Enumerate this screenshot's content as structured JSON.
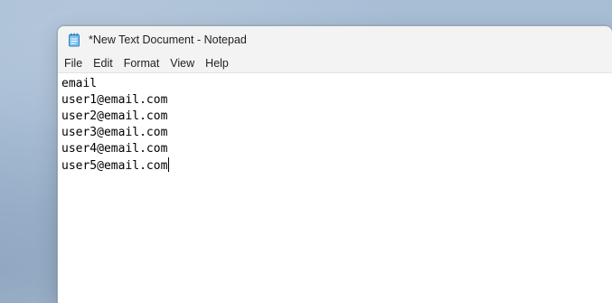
{
  "window": {
    "title": "*New Text Document - Notepad",
    "icon": "notepad-icon"
  },
  "menu": {
    "items": [
      {
        "label": "File"
      },
      {
        "label": "Edit"
      },
      {
        "label": "Format"
      },
      {
        "label": "View"
      },
      {
        "label": "Help"
      }
    ]
  },
  "document": {
    "lines": [
      "email",
      "user1@email.com",
      "user2@email.com",
      "user3@email.com",
      "user4@email.com",
      "user5@email.com"
    ]
  }
}
